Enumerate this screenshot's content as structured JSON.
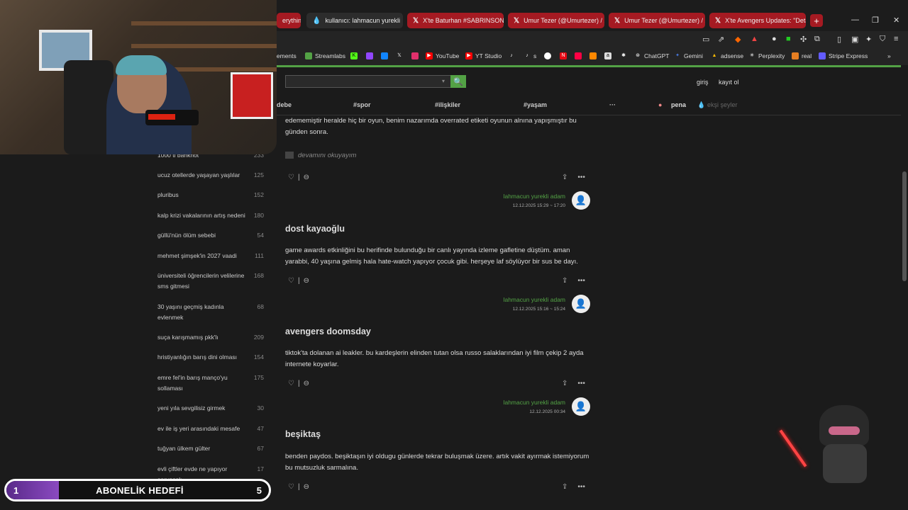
{
  "browser": {
    "tabs": [
      {
        "label": "erything!",
        "icon": "",
        "style": "red"
      },
      {
        "label": "kullanıcı: lahmacun yurekli",
        "icon": "💧",
        "style": "active"
      },
      {
        "label": "X'te Baturhan #SABRINSONUS",
        "icon": "𝕏",
        "style": "red"
      },
      {
        "label": "Umur Tezer (@Umurtezer) / X",
        "icon": "𝕏",
        "style": "red"
      },
      {
        "label": "Umur Tezer (@Umurtezer) / X",
        "icon": "𝕏",
        "style": "red"
      },
      {
        "label": "X'te Avengers Updates: \"Detail",
        "icon": "𝕏",
        "style": "red"
      }
    ],
    "new_tab": "+",
    "window_controls": {
      "min": "—",
      "max": "❐",
      "close": "✕"
    },
    "bookmarks": [
      {
        "label": "lements",
        "color": "#444"
      },
      {
        "label": "Streamlabs",
        "color": "#53a245"
      },
      {
        "label": "",
        "color": "#53fc18"
      },
      {
        "label": "",
        "color": "#9146ff"
      },
      {
        "label": "",
        "color": "#1185fe"
      },
      {
        "label": "",
        "color": "#333"
      },
      {
        "label": "",
        "color": "#e1306c"
      },
      {
        "label": "YouTube",
        "color": "#f00"
      },
      {
        "label": "YT Studio",
        "color": "#f00"
      },
      {
        "label": "s",
        "color": "#333"
      },
      {
        "label": "",
        "color": "#333"
      },
      {
        "label": "",
        "color": "#e50914"
      },
      {
        "label": "",
        "color": "#f04"
      },
      {
        "label": "",
        "color": "#f80"
      },
      {
        "label": "",
        "color": "#333"
      },
      {
        "label": "",
        "color": "#333"
      },
      {
        "label": "ChatGPT",
        "color": "#333"
      },
      {
        "label": "Gemini",
        "color": "#4a7de8"
      },
      {
        "label": "adsense",
        "color": "#fbbc04"
      },
      {
        "label": "Perplexity",
        "color": "#333"
      },
      {
        "label": "real",
        "color": "#e67e22"
      },
      {
        "label": "Stripe Express",
        "color": "#635bff"
      }
    ]
  },
  "site": {
    "login": "giriş",
    "register": "kayıt ol",
    "nav": [
      "debe",
      "#spor",
      "#ilişkiler",
      "#yaşam",
      "···"
    ],
    "pena": "pena",
    "eksi_seyler": "ekşi şeyler",
    "search_button": "🔍"
  },
  "sidebar": {
    "topics": [
      {
        "title": "1000 tl banknot",
        "count": "233"
      },
      {
        "title": "ucuz otellerde yaşayan yaşlılar",
        "count": "125"
      },
      {
        "title": "pluribus",
        "count": "152"
      },
      {
        "title": "kalp krizi vakalarının artış nedeni",
        "count": "180"
      },
      {
        "title": "güllü'nün ölüm sebebi",
        "count": "54"
      },
      {
        "title": "mehmet şimşek'in 2027 vaadi",
        "count": "111"
      },
      {
        "title": "üniversiteli öğrencilerin velilerine sms gitmesi",
        "count": "168"
      },
      {
        "title": "30 yaşını geçmiş kadınla evlenmek",
        "count": "68"
      },
      {
        "title": "suça karışmamış pkk'lı",
        "count": "209"
      },
      {
        "title": "hristiyanlığın barış dini olması",
        "count": "154"
      },
      {
        "title": "emre fel'in barış manço'yu sollaması",
        "count": "175"
      },
      {
        "title": "yeni yıla sevgilisiz girmek",
        "count": "30"
      },
      {
        "title": "ev ile iş yeri arasındaki mesafe",
        "count": "47"
      },
      {
        "title": "tuğyan ülkem gülter",
        "count": "67"
      },
      {
        "title": "evli çiftler evde ne yapıyor sorunsalı",
        "count": "17"
      }
    ]
  },
  "entries": [
    {
      "title": "",
      "text": "edememiştir heralde hiç bir oyun, benim nazarımda overrated etiketi oyunun alnına yapışmıştır bu günden sonra.",
      "read_more": "devamını okuyayım",
      "author": "lahmacun yurekli adam",
      "date": "12.12.2025 15:29 ~ 17:20"
    },
    {
      "title": "dost kayaoğlu",
      "text": "game awards etkinliğini bu herifinde bulunduğu bir canlı yayında izleme gafletine düştüm. aman yarabbi, 40 yaşına gelmiş hala hate-watch yapıyor çocuk gibi. herşeye laf söylüyor bir sus be dayı.",
      "author": "lahmacun yurekli adam",
      "date": "12.12.2025 15:16 ~ 15:24"
    },
    {
      "title": "avengers doomsday",
      "text": "tiktok'ta dolanan ai leakler. bu kardeşlerin elinden tutan olsa russo salaklarından iyi film çekip 2 ayda internete koyarlar.",
      "author": "lahmacun yurekli adam",
      "date": "12.12.2025 00:34"
    },
    {
      "title": "beşiktaş",
      "text": "benden paydos. beşiktaşın iyi oldugu günlerde tekrar buluşmak üzere. artık vakit ayırmak istemiyorum bu mutsuzluk sarmalına.",
      "author": "",
      "date": ""
    }
  ],
  "entry_actions": {
    "like": "♡",
    "sep": "|",
    "dislike": "⊖",
    "share": "⇪",
    "more": "•••"
  },
  "goal": {
    "current": "1",
    "label": "ABONELİK HEDEFİ",
    "target": "5",
    "progress": 0.2
  },
  "colors": {
    "accent": "#53a245",
    "tab_red": "#a51a22",
    "goal_purple": "#8a4ac0"
  }
}
